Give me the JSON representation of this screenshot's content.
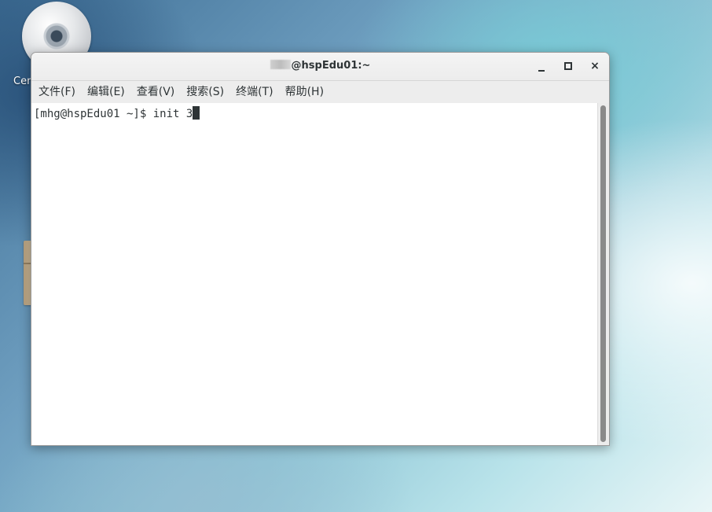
{
  "desktop": {
    "cd_icon_label": "Cen"
  },
  "window": {
    "title_visible": "@hspEdu01:~",
    "buttons": {
      "minimize": "minimize",
      "maximize": "maximize",
      "close": "×"
    }
  },
  "menubar": {
    "items": [
      {
        "label": "文件(F)"
      },
      {
        "label": "编辑(E)"
      },
      {
        "label": "查看(V)"
      },
      {
        "label": "搜索(S)"
      },
      {
        "label": "终端(T)"
      },
      {
        "label": "帮助(H)"
      }
    ]
  },
  "terminal": {
    "prompt": "[mhg@hspEdu01 ~]$ ",
    "command": "init 3"
  },
  "icons": {
    "cd": "disc-icon",
    "folder": "folder-icon",
    "minimize": "minimize-icon",
    "maximize": "maximize-icon",
    "close": "close-icon"
  }
}
